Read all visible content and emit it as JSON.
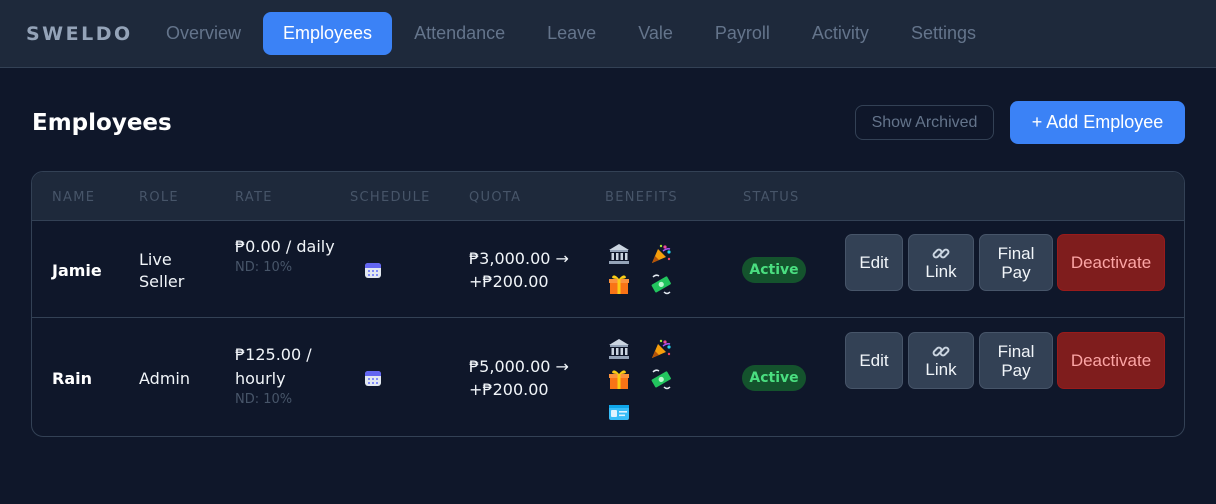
{
  "nav": {
    "brand": "SWELDO",
    "tabs": [
      {
        "label": "Overview"
      },
      {
        "label": "Employees"
      },
      {
        "label": "Attendance"
      },
      {
        "label": "Leave"
      },
      {
        "label": "Vale"
      },
      {
        "label": "Payroll"
      },
      {
        "label": "Activity"
      },
      {
        "label": "Settings"
      }
    ],
    "active_tab": "Employees"
  },
  "page": {
    "title": "Employees",
    "show_archived_label": "Show Archived",
    "add_employee_label": "+ Add Employee"
  },
  "table": {
    "columns": [
      "Name",
      "Role",
      "Rate",
      "Schedule",
      "Quota",
      "Benefits",
      "Status"
    ],
    "rows": [
      {
        "name": "Jamie",
        "role": "Live Seller",
        "rate": "₱0.00 / daily",
        "rate_note": "ND: 10%",
        "schedule_icon": "calendar-icon",
        "quota": "₱3,000.00 → +₱200.00",
        "benefits": [
          "bank-icon",
          "party-popper-icon",
          "gift-icon",
          "money-flying-icon"
        ],
        "status": "Active",
        "actions": {
          "edit": "Edit",
          "link": "Link",
          "final_pay": "Final Pay",
          "deactivate": "Deactivate"
        }
      },
      {
        "name": "Rain",
        "role": "Admin",
        "rate": "₱125.00 / hourly",
        "rate_note": "ND: 10%",
        "schedule_icon": "calendar-icon",
        "quota": "₱5,000.00 → +₱200.00",
        "benefits": [
          "bank-icon",
          "party-popper-icon",
          "gift-icon",
          "money-flying-icon",
          "id-card-icon"
        ],
        "status": "Active",
        "actions": {
          "edit": "Edit",
          "link": "Link",
          "final_pay": "Final Pay",
          "deactivate": "Deactivate"
        }
      }
    ]
  },
  "colors": {
    "background": "#0f172a",
    "surface": "#1e293b",
    "accent": "#3b82f6",
    "status_active_bg": "#14532d",
    "status_active_text": "#4ade80",
    "danger": "#7f1d1d"
  }
}
